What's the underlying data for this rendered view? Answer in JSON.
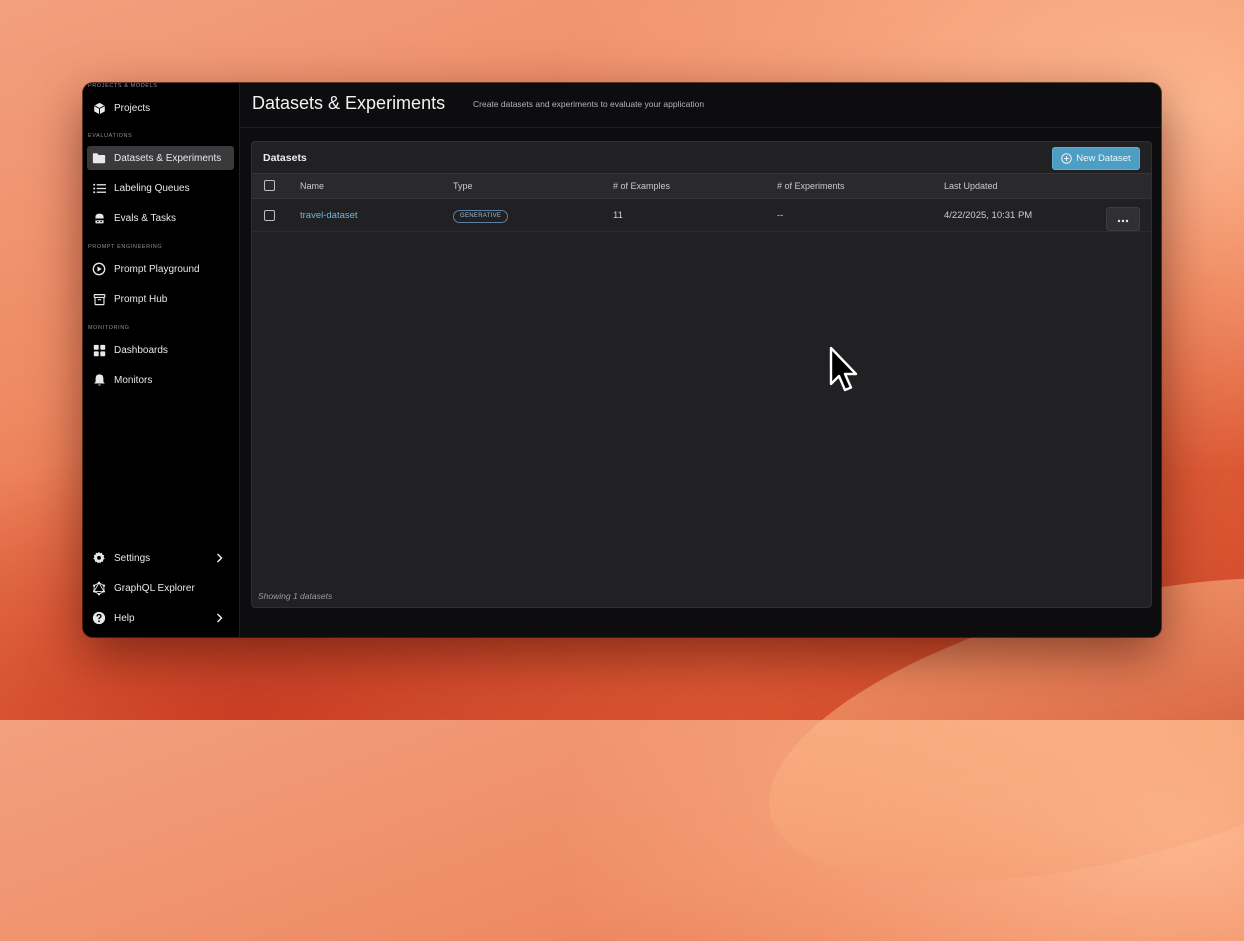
{
  "sidebar": {
    "sections": {
      "projects_models": "PROJECTS & MODELS",
      "evaluations": "EVALUATIONS",
      "prompt_engineering": "PROMPT ENGINEERING",
      "monitoring": "MONITORING"
    },
    "items": {
      "projects": {
        "label": "Projects",
        "icon": "cube-icon"
      },
      "datasets": {
        "label": "Datasets & Experiments",
        "icon": "folder-icon"
      },
      "labeling": {
        "label": "Labeling Queues",
        "icon": "list-icon"
      },
      "evals": {
        "label": "Evals & Tasks",
        "icon": "robot-icon"
      },
      "playground": {
        "label": "Prompt Playground",
        "icon": "play-circle-icon"
      },
      "hub": {
        "label": "Prompt Hub",
        "icon": "archive-icon"
      },
      "dashboards": {
        "label": "Dashboards",
        "icon": "grid-icon"
      },
      "monitors": {
        "label": "Monitors",
        "icon": "bell-icon"
      },
      "settings": {
        "label": "Settings",
        "icon": "gear-icon"
      },
      "graphql": {
        "label": "GraphQL Explorer",
        "icon": "graphql-icon"
      },
      "help": {
        "label": "Help",
        "icon": "help-circle-icon"
      }
    }
  },
  "header": {
    "title": "Datasets & Experiments",
    "subtitle": "Create datasets and experiments to evaluate your application"
  },
  "panel": {
    "title": "Datasets",
    "new_button": "New Dataset",
    "columns": [
      "Name",
      "Type",
      "# of Examples",
      "# of Experiments",
      "Last Updated"
    ],
    "rows": [
      {
        "name": "travel-dataset",
        "type": "GENERATIVE",
        "examples": "11",
        "experiments": "--",
        "updated": "4/22/2025, 10:31 PM"
      }
    ],
    "footer": "Showing 1 datasets"
  },
  "colors": {
    "accent": "#4d9ec2",
    "link": "#6fb6dc",
    "active_nav": "#3a3a3d"
  }
}
